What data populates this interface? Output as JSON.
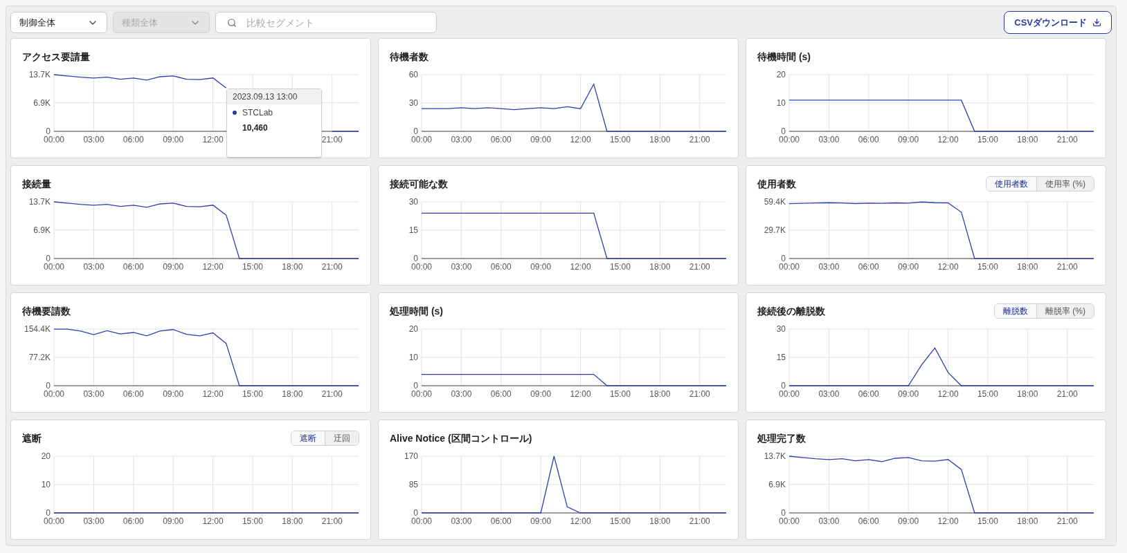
{
  "toolbar": {
    "filters": [
      {
        "label": "制御全体",
        "disabled": false
      },
      {
        "label": "種類全体",
        "disabled": true
      }
    ],
    "search": {
      "placeholder": "比較セグメント"
    },
    "download_button": "CSVダウンロード"
  },
  "cards": [
    {
      "title": "アクセス要請量",
      "tooltip": {
        "title": "2023.09.13 13:00",
        "series": "STCLab",
        "value": "10,460",
        "color": "#2d3a9e"
      },
      "chart_data": {
        "type": "line",
        "x": [
          0,
          1,
          2,
          3,
          4,
          5,
          6,
          7,
          8,
          9,
          10,
          11,
          12,
          13,
          14,
          15,
          16,
          17,
          18,
          19,
          20,
          21,
          22,
          23
        ],
        "xlim": [
          0,
          23
        ],
        "ylim": [
          0,
          13700
        ],
        "grid": true,
        "xticks": [
          {
            "value": 0,
            "label": "00:00"
          },
          {
            "value": 3,
            "label": "03:00"
          },
          {
            "value": 6,
            "label": "06:00"
          },
          {
            "value": 9,
            "label": "09:00"
          },
          {
            "value": 12,
            "label": "12:00"
          },
          {
            "value": 21,
            "label": "21:00"
          }
        ],
        "yticks": [
          0,
          {
            "value": 6900,
            "label": "6.9K"
          },
          {
            "value": 13700,
            "label": "13.7K"
          }
        ],
        "series": [
          {
            "color": "#2d3fb0",
            "values": [
              13700,
              13400,
              13100,
              12900,
              13100,
              12600,
              12900,
              12400,
              13200,
              13400,
              12600,
              12500,
              12900,
              10500,
              null,
              null,
              null,
              null,
              null,
              null,
              null,
              0,
              0,
              0
            ]
          }
        ]
      }
    },
    {
      "title": "待機者数",
      "chart_data": {
        "type": "line",
        "x": [
          0,
          1,
          2,
          3,
          4,
          5,
          6,
          7,
          8,
          9,
          10,
          11,
          12,
          13,
          14,
          15,
          16,
          17,
          18,
          19,
          20,
          21,
          22,
          23
        ],
        "xlim": [
          0,
          23
        ],
        "ylim": [
          0,
          60
        ],
        "grid": true,
        "xticks": [
          {
            "value": 0,
            "label": "00:00"
          },
          {
            "value": 3,
            "label": "03:00"
          },
          {
            "value": 6,
            "label": "06:00"
          },
          {
            "value": 9,
            "label": "09:00"
          },
          {
            "value": 12,
            "label": "12:00"
          },
          {
            "value": 15,
            "label": "15:00"
          },
          {
            "value": 18,
            "label": "18:00"
          },
          {
            "value": 21,
            "label": "21:00"
          }
        ],
        "yticks": [
          0,
          30,
          60
        ],
        "series": [
          {
            "color": "#2d3fb0",
            "values": [
              24,
              24,
              24,
              25,
              24,
              25,
              24,
              23,
              24,
              25,
              24,
              26,
              24,
              50,
              0,
              0,
              0,
              0,
              0,
              0,
              0,
              0,
              0,
              0
            ]
          }
        ]
      }
    },
    {
      "title": "待機時間 (s)",
      "chart_data": {
        "type": "line",
        "x": [
          0,
          1,
          2,
          3,
          4,
          5,
          6,
          7,
          8,
          9,
          10,
          11,
          12,
          13,
          14,
          15,
          16,
          17,
          18,
          19,
          20,
          21,
          22,
          23
        ],
        "xlim": [
          0,
          23
        ],
        "ylim": [
          0,
          20
        ],
        "grid": true,
        "xticks": [
          {
            "value": 0,
            "label": "00:00"
          },
          {
            "value": 3,
            "label": "03:00"
          },
          {
            "value": 6,
            "label": "06:00"
          },
          {
            "value": 9,
            "label": "09:00"
          },
          {
            "value": 12,
            "label": "12:00"
          },
          {
            "value": 15,
            "label": "15:00"
          },
          {
            "value": 18,
            "label": "18:00"
          },
          {
            "value": 21,
            "label": "21:00"
          }
        ],
        "yticks": [
          0,
          10,
          20
        ],
        "series": [
          {
            "color": "#2d3fb0",
            "values": [
              11,
              11,
              11,
              11,
              11,
              11,
              11,
              11,
              11,
              11,
              11,
              11,
              11,
              11,
              0,
              0,
              0,
              0,
              0,
              0,
              0,
              0,
              0,
              0
            ]
          }
        ]
      }
    },
    {
      "title": "接続量",
      "chart_data": {
        "type": "line",
        "x": [
          0,
          1,
          2,
          3,
          4,
          5,
          6,
          7,
          8,
          9,
          10,
          11,
          12,
          13,
          14,
          15,
          16,
          17,
          18,
          19,
          20,
          21,
          22,
          23
        ],
        "xlim": [
          0,
          23
        ],
        "ylim": [
          0,
          13700
        ],
        "grid": true,
        "xticks": [
          {
            "value": 0,
            "label": "00:00"
          },
          {
            "value": 3,
            "label": "03:00"
          },
          {
            "value": 6,
            "label": "06:00"
          },
          {
            "value": 9,
            "label": "09:00"
          },
          {
            "value": 12,
            "label": "12:00"
          },
          {
            "value": 15,
            "label": "15:00"
          },
          {
            "value": 18,
            "label": "18:00"
          },
          {
            "value": 21,
            "label": "21:00"
          }
        ],
        "yticks": [
          0,
          {
            "value": 6900,
            "label": "6.9K"
          },
          {
            "value": 13700,
            "label": "13.7K"
          }
        ],
        "series": [
          {
            "color": "#2d3fb0",
            "values": [
              13700,
              13400,
              13100,
              12900,
              13100,
              12600,
              12900,
              12400,
              13200,
              13400,
              12600,
              12500,
              12900,
              10500,
              0,
              0,
              0,
              0,
              0,
              0,
              0,
              0,
              0,
              0
            ]
          }
        ]
      }
    },
    {
      "title": "接続可能な数",
      "chart_data": {
        "type": "line",
        "x": [
          0,
          1,
          2,
          3,
          4,
          5,
          6,
          7,
          8,
          9,
          10,
          11,
          12,
          13,
          14,
          15,
          16,
          17,
          18,
          19,
          20,
          21,
          22,
          23
        ],
        "xlim": [
          0,
          23
        ],
        "ylim": [
          0,
          30
        ],
        "grid": true,
        "xticks": [
          {
            "value": 0,
            "label": "00:00"
          },
          {
            "value": 3,
            "label": "03:00"
          },
          {
            "value": 6,
            "label": "06:00"
          },
          {
            "value": 9,
            "label": "09:00"
          },
          {
            "value": 12,
            "label": "12:00"
          },
          {
            "value": 15,
            "label": "15:00"
          },
          {
            "value": 18,
            "label": "18:00"
          },
          {
            "value": 21,
            "label": "21:00"
          }
        ],
        "yticks": [
          0,
          15,
          30
        ],
        "series": [
          {
            "color": "#2d3fb0",
            "values": [
              24,
              24,
              24,
              24,
              24,
              24,
              24,
              24,
              24,
              24,
              24,
              24,
              24,
              24,
              0,
              0,
              0,
              0,
              0,
              0,
              0,
              0,
              0,
              0
            ]
          }
        ]
      }
    },
    {
      "title": "使用者数",
      "toggle": [
        {
          "label": "使用者数",
          "selected": true
        },
        {
          "label": "使用率 (%)",
          "selected": false
        }
      ],
      "chart_data": {
        "type": "line",
        "x": [
          0,
          1,
          2,
          3,
          4,
          5,
          6,
          7,
          8,
          9,
          10,
          11,
          12,
          13,
          14,
          15,
          16,
          17,
          18,
          19,
          20,
          21,
          22,
          23
        ],
        "xlim": [
          0,
          23
        ],
        "ylim": [
          0,
          59400
        ],
        "grid": true,
        "xticks": [
          {
            "value": 0,
            "label": "00:00"
          },
          {
            "value": 3,
            "label": "03:00"
          },
          {
            "value": 6,
            "label": "06:00"
          },
          {
            "value": 9,
            "label": "09:00"
          },
          {
            "value": 12,
            "label": "12:00"
          },
          {
            "value": 15,
            "label": "15:00"
          },
          {
            "value": 18,
            "label": "18:00"
          },
          {
            "value": 21,
            "label": "21:00"
          }
        ],
        "yticks": [
          0,
          {
            "value": 29700,
            "label": "29.7K"
          },
          {
            "value": 59400,
            "label": "59.4K"
          }
        ],
        "series": [
          {
            "color": "#2d3fb0",
            "values": [
              57500,
              57800,
              58200,
              58500,
              58200,
              57600,
              58000,
              57800,
              58300,
              58000,
              59200,
              58500,
              58300,
              48500,
              0,
              0,
              0,
              0,
              0,
              0,
              0,
              0,
              0,
              0
            ]
          }
        ]
      }
    },
    {
      "title": "待機要請数",
      "chart_data": {
        "type": "line",
        "x": [
          0,
          1,
          2,
          3,
          4,
          5,
          6,
          7,
          8,
          9,
          10,
          11,
          12,
          13,
          14,
          15,
          16,
          17,
          18,
          19,
          20,
          21,
          22,
          23
        ],
        "xlim": [
          0,
          23
        ],
        "ylim": [
          0,
          154400
        ],
        "grid": true,
        "xticks": [
          {
            "value": 0,
            "label": "00:00"
          },
          {
            "value": 3,
            "label": "03:00"
          },
          {
            "value": 6,
            "label": "06:00"
          },
          {
            "value": 9,
            "label": "09:00"
          },
          {
            "value": 12,
            "label": "12:00"
          },
          {
            "value": 15,
            "label": "15:00"
          },
          {
            "value": 18,
            "label": "18:00"
          },
          {
            "value": 21,
            "label": "21:00"
          }
        ],
        "yticks": [
          0,
          {
            "value": 77200,
            "label": "77.2K"
          },
          {
            "value": 154400,
            "label": "154.4K"
          }
        ],
        "series": [
          {
            "color": "#2d3fb0",
            "values": [
              154000,
              154000,
              149000,
              139000,
              150000,
              141000,
              145000,
              136000,
              149000,
              153000,
              140000,
              136000,
              144000,
              115000,
              0,
              0,
              0,
              0,
              0,
              0,
              0,
              0,
              0,
              0
            ]
          }
        ]
      }
    },
    {
      "title": "処理時間 (s)",
      "chart_data": {
        "type": "line",
        "x": [
          0,
          1,
          2,
          3,
          4,
          5,
          6,
          7,
          8,
          9,
          10,
          11,
          12,
          13,
          14,
          15,
          16,
          17,
          18,
          19,
          20,
          21,
          22,
          23
        ],
        "xlim": [
          0,
          23
        ],
        "ylim": [
          0,
          20
        ],
        "grid": true,
        "xticks": [
          {
            "value": 0,
            "label": "00:00"
          },
          {
            "value": 3,
            "label": "03:00"
          },
          {
            "value": 6,
            "label": "06:00"
          },
          {
            "value": 9,
            "label": "09:00"
          },
          {
            "value": 12,
            "label": "12:00"
          },
          {
            "value": 15,
            "label": "15:00"
          },
          {
            "value": 18,
            "label": "18:00"
          },
          {
            "value": 21,
            "label": "21:00"
          }
        ],
        "yticks": [
          0,
          10,
          20
        ],
        "series": [
          {
            "color": "#2d3fb0",
            "values": [
              4,
              4,
              4,
              4,
              4,
              4,
              4,
              4,
              4,
              4,
              4,
              4,
              4,
              4,
              0,
              0,
              0,
              0,
              0,
              0,
              0,
              0,
              0,
              0
            ]
          }
        ]
      }
    },
    {
      "title": "接続後の離脱数",
      "toggle": [
        {
          "label": "離脱数",
          "selected": true
        },
        {
          "label": "離脱率 (%)",
          "selected": false
        }
      ],
      "chart_data": {
        "type": "line",
        "x": [
          0,
          1,
          2,
          3,
          4,
          5,
          6,
          7,
          8,
          9,
          10,
          11,
          12,
          13,
          14,
          15,
          16,
          17,
          18,
          19,
          20,
          21,
          22,
          23
        ],
        "xlim": [
          0,
          23
        ],
        "ylim": [
          0,
          30
        ],
        "grid": true,
        "xticks": [
          {
            "value": 0,
            "label": "00:00"
          },
          {
            "value": 3,
            "label": "03:00"
          },
          {
            "value": 6,
            "label": "06:00"
          },
          {
            "value": 9,
            "label": "09:00"
          },
          {
            "value": 12,
            "label": "12:00"
          },
          {
            "value": 15,
            "label": "15:00"
          },
          {
            "value": 18,
            "label": "18:00"
          },
          {
            "value": 21,
            "label": "21:00"
          }
        ],
        "yticks": [
          0,
          15,
          30
        ],
        "series": [
          {
            "color": "#2d3fb0",
            "values": [
              0,
              0,
              0,
              0,
              0,
              0,
              0,
              0,
              0,
              0,
              11,
              20,
              7,
              0,
              0,
              0,
              0,
              0,
              0,
              0,
              0,
              0,
              0,
              0
            ]
          }
        ]
      }
    },
    {
      "title": "遮断",
      "toggle": [
        {
          "label": "遮断",
          "selected": true
        },
        {
          "label": "迂回",
          "selected": false
        }
      ],
      "chart_data": {
        "type": "line",
        "x": [
          0,
          1,
          2,
          3,
          4,
          5,
          6,
          7,
          8,
          9,
          10,
          11,
          12,
          13,
          14,
          15,
          16,
          17,
          18,
          19,
          20,
          21,
          22,
          23
        ],
        "xlim": [
          0,
          23
        ],
        "ylim": [
          0,
          20
        ],
        "grid": true,
        "xticks": [
          {
            "value": 0,
            "label": "00:00"
          },
          {
            "value": 3,
            "label": "03:00"
          },
          {
            "value": 6,
            "label": "06:00"
          },
          {
            "value": 9,
            "label": "09:00"
          },
          {
            "value": 12,
            "label": "12:00"
          },
          {
            "value": 15,
            "label": "15:00"
          },
          {
            "value": 18,
            "label": "18:00"
          },
          {
            "value": 21,
            "label": "21:00"
          }
        ],
        "yticks": [
          0,
          10,
          20
        ],
        "series": [
          {
            "color": "#2d3fb0",
            "values": [
              0,
              0,
              0,
              0,
              0,
              0,
              0,
              0,
              0,
              0,
              0,
              0,
              0,
              0,
              0,
              0,
              0,
              0,
              0,
              0,
              0,
              0,
              0,
              0
            ]
          }
        ]
      }
    },
    {
      "title": "Alive Notice (区間コントロール)",
      "chart_data": {
        "type": "line",
        "x": [
          0,
          1,
          2,
          3,
          4,
          5,
          6,
          7,
          8,
          9,
          10,
          11,
          12,
          13,
          14,
          15,
          16,
          17,
          18,
          19,
          20,
          21,
          22,
          23
        ],
        "xlim": [
          0,
          23
        ],
        "ylim": [
          0,
          170
        ],
        "grid": true,
        "xticks": [
          {
            "value": 0,
            "label": "00:00"
          },
          {
            "value": 3,
            "label": "03:00"
          },
          {
            "value": 6,
            "label": "06:00"
          },
          {
            "value": 9,
            "label": "09:00"
          },
          {
            "value": 12,
            "label": "12:00"
          },
          {
            "value": 15,
            "label": "15:00"
          },
          {
            "value": 18,
            "label": "18:00"
          },
          {
            "value": 21,
            "label": "21:00"
          }
        ],
        "yticks": [
          0,
          85,
          170
        ],
        "series": [
          {
            "color": "#2d3fb0",
            "values": [
              0,
              0,
              0,
              0,
              0,
              0,
              0,
              0,
              0,
              0,
              170,
              18,
              0,
              0,
              0,
              0,
              0,
              0,
              0,
              0,
              0,
              0,
              0,
              0
            ]
          }
        ]
      }
    },
    {
      "title": "処理完了数",
      "chart_data": {
        "type": "line",
        "x": [
          0,
          1,
          2,
          3,
          4,
          5,
          6,
          7,
          8,
          9,
          10,
          11,
          12,
          13,
          14,
          15,
          16,
          17,
          18,
          19,
          20,
          21,
          22,
          23
        ],
        "xlim": [
          0,
          23
        ],
        "ylim": [
          0,
          13700
        ],
        "grid": true,
        "xticks": [
          {
            "value": 0,
            "label": "00:00"
          },
          {
            "value": 3,
            "label": "03:00"
          },
          {
            "value": 6,
            "label": "06:00"
          },
          {
            "value": 9,
            "label": "09:00"
          },
          {
            "value": 12,
            "label": "12:00"
          },
          {
            "value": 15,
            "label": "15:00"
          },
          {
            "value": 18,
            "label": "18:00"
          },
          {
            "value": 21,
            "label": "21:00"
          }
        ],
        "yticks": [
          0,
          {
            "value": 6900,
            "label": "6.9K"
          },
          {
            "value": 13700,
            "label": "13.7K"
          }
        ],
        "series": [
          {
            "color": "#2d3fb0",
            "values": [
              13700,
              13400,
              13100,
              12900,
              13100,
              12600,
              12900,
              12400,
              13200,
              13400,
              12600,
              12500,
              12900,
              10500,
              0,
              0,
              0,
              0,
              0,
              0,
              0,
              0,
              0,
              0
            ]
          }
        ]
      }
    }
  ]
}
